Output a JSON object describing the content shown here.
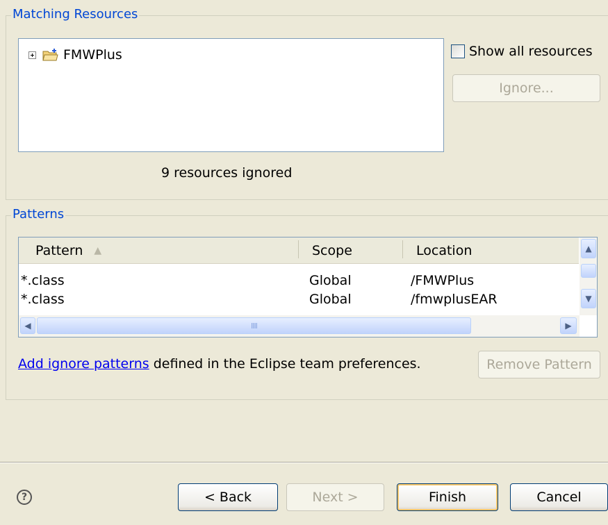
{
  "matching": {
    "group_label": "Matching Resources",
    "tree_item_label": "FMWPlus",
    "tree_expander": "⊞",
    "show_all_label": "Show all resources",
    "ignore_label": "Ignore...",
    "status": "9 resources ignored"
  },
  "patterns": {
    "group_label": "Patterns",
    "columns": [
      "Pattern",
      "Scope",
      "Location"
    ],
    "sort_indicator": "▲",
    "rows": [
      {
        "pattern": "*.class",
        "scope": "Global",
        "location": "/FMWPlus"
      },
      {
        "pattern": "*.class",
        "scope": "Global",
        "location": "/fmwplusEAR"
      }
    ],
    "hscroll_grip": "IIII",
    "add_link": "Add ignore patterns",
    "add_suffix": " defined in the Eclipse team preferences.",
    "remove_label": "Remove Pattern"
  },
  "footer": {
    "help": "?",
    "back": "< Back",
    "next": "Next >",
    "finish": "Finish",
    "cancel": "Cancel"
  },
  "icons": {
    "expand": "plus-square-icon",
    "project": "folder-icon",
    "help": "help-icon"
  }
}
